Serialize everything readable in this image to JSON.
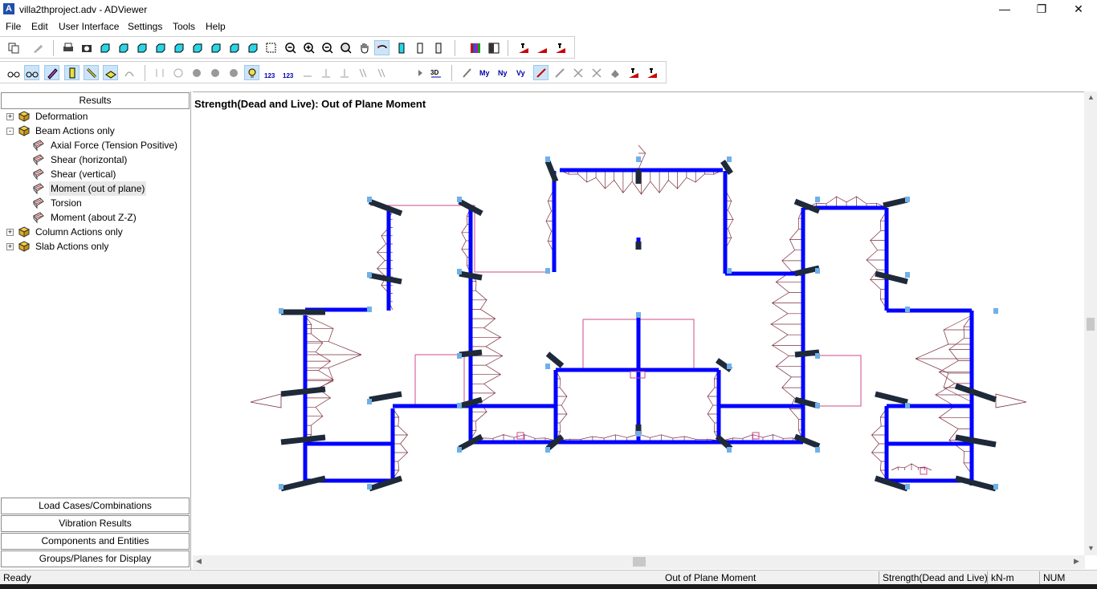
{
  "window": {
    "title": "villa2thproject.adv - ADViewer",
    "icon_letter": "A",
    "controls": [
      "—",
      "❐",
      "✕"
    ]
  },
  "menu": [
    "File",
    "Edit",
    "User Interface",
    "Settings",
    "Tools",
    "Help"
  ],
  "sidebar": {
    "header": "Results",
    "tree": [
      {
        "label": "Deformation",
        "level": 0,
        "expander": "+",
        "icon": "folder-icon"
      },
      {
        "label": "Beam Actions only",
        "level": 0,
        "expander": "-",
        "icon": "folder-icon"
      },
      {
        "label": "Axial Force (Tension Positive)",
        "level": 1,
        "icon": "result-icon"
      },
      {
        "label": "Shear (horizontal)",
        "level": 1,
        "icon": "result-icon"
      },
      {
        "label": "Shear (vertical)",
        "level": 1,
        "icon": "result-icon"
      },
      {
        "label": "Moment (out of plane)",
        "level": 1,
        "icon": "result-icon",
        "selected": true
      },
      {
        "label": "Torsion",
        "level": 1,
        "icon": "result-icon"
      },
      {
        "label": "Moment (about Z-Z)",
        "level": 1,
        "icon": "result-icon"
      },
      {
        "label": "Column Actions only",
        "level": 0,
        "expander": "+",
        "icon": "folder-icon"
      },
      {
        "label": "Slab Actions only",
        "level": 0,
        "expander": "+",
        "icon": "folder-icon"
      }
    ],
    "panels": [
      "Load Cases/Combinations",
      "Vibration Results",
      "Components and Entities",
      "Groups/Planes for Display"
    ]
  },
  "plot": {
    "title": "Strength(Dead and Live): Out of Plane Moment",
    "colors": {
      "beam": "#0000ff",
      "column": "#1e2a3a",
      "node": "#6fb1e8",
      "diagram": "#7a2d3c",
      "slab": "#d2488a"
    },
    "toolbar2_3d_label": "3D"
  },
  "status": {
    "ready": "Ready",
    "result": "Out of Plane Moment",
    "case": "Strength(Dead and Live)",
    "units": "kN-m",
    "num": "NUM"
  }
}
